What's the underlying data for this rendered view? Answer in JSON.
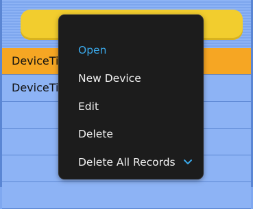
{
  "list": {
    "rows": [
      {
        "label": "DeviceTi"
      },
      {
        "label": "DeviceTi"
      }
    ]
  },
  "context_menu": {
    "items": [
      {
        "label": "Open"
      },
      {
        "label": "New Device"
      },
      {
        "label": "Edit"
      },
      {
        "label": "Delete"
      },
      {
        "label": "Delete All Records"
      }
    ],
    "more_icon": "chevron-down-icon"
  },
  "colors": {
    "accent_active": "#3aa7e8",
    "selected_row": "#f6a623",
    "header": "#f2cd2e",
    "background": "#8db3f5",
    "menu_background": "#1c1c1c"
  }
}
